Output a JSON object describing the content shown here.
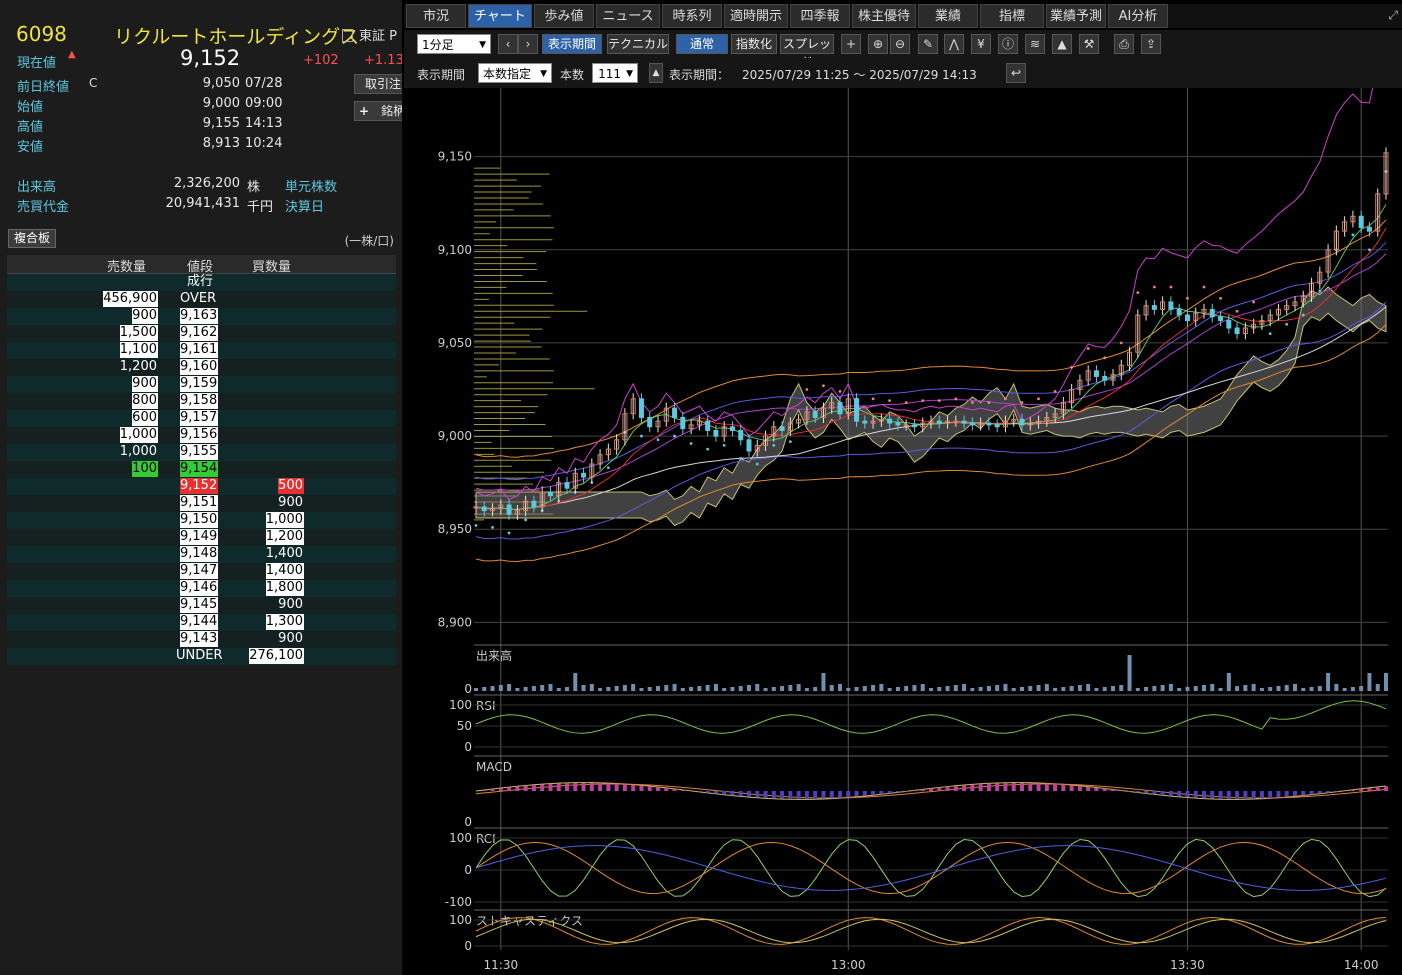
{
  "quote": {
    "code": "6098",
    "name": "リクルートホールディングス",
    "market": "東証 P",
    "current_label": "現在値",
    "current_price": "9,152",
    "change": "+102",
    "change_pct": "+1.13",
    "prev_close_label": "前日終値",
    "prev_close_flag": "C",
    "prev_close": "9,050",
    "prev_close_date": "07/28",
    "open_label": "始値",
    "open": "9,000",
    "open_time": "09:00",
    "high_label": "高値",
    "high": "9,155",
    "high_time": "14:13",
    "low_label": "安値",
    "low": "8,913",
    "low_time": "10:24",
    "volume_label": "出来高",
    "volume": "2,326,200",
    "volume_unit": "株",
    "turnover_label": "売買代金",
    "turnover": "20,941,431",
    "turnover_unit": "千円",
    "unit_shares_label": "単元株数",
    "settlement_label": "決算日",
    "side_btn1": "取引注",
    "side_btn2": "銘柄"
  },
  "board": {
    "button": "複合板",
    "unit": "(一株/口)",
    "headers": [
      "売数量",
      "値段",
      "買数量"
    ],
    "market_order": "成行",
    "over_qty": "456,900",
    "over_label": "OVER",
    "under_label": "UNDER",
    "under_qty": "276,100",
    "asks": [
      {
        "qty": "900",
        "price": "9,163"
      },
      {
        "qty": "1,500",
        "price": "9,162"
      },
      {
        "qty": "1,100",
        "price": "9,161"
      },
      {
        "qty": "1,200",
        "price": "9,160"
      },
      {
        "qty": "900",
        "price": "9,159"
      },
      {
        "qty": "800",
        "price": "9,158"
      },
      {
        "qty": "600",
        "price": "9,157"
      },
      {
        "qty": "1,000",
        "price": "9,156"
      },
      {
        "qty": "1,000",
        "price": "9,155"
      },
      {
        "qty": "100",
        "price": "9,154"
      }
    ],
    "bids": [
      {
        "price": "9,152",
        "qty": "500"
      },
      {
        "price": "9,151",
        "qty": "900"
      },
      {
        "price": "9,150",
        "qty": "1,000"
      },
      {
        "price": "9,149",
        "qty": "1,200"
      },
      {
        "price": "9,148",
        "qty": "1,400"
      },
      {
        "price": "9,147",
        "qty": "1,400"
      },
      {
        "price": "9,146",
        "qty": "1,800"
      },
      {
        "price": "9,145",
        "qty": "900"
      },
      {
        "price": "9,144",
        "qty": "1,300"
      },
      {
        "price": "9,143",
        "qty": "900"
      }
    ]
  },
  "tabs": [
    "市況",
    "チャート",
    "歩み値",
    "ニュース",
    "時系列",
    "適時開示",
    "四季報",
    "株主優待",
    "業績",
    "指標",
    "業績予測",
    "AI分析"
  ],
  "toolbar": {
    "interval": "1分足",
    "period_btn": "表示期間",
    "technical_btn": "テクニカル",
    "normal_btn": "通常",
    "index_btn": "指数化",
    "spread_btn": "スプレッド",
    "period_label": "表示期間",
    "period_mode": "本数指定",
    "count_label": "本数",
    "count": "111",
    "range_label": "表示期間：",
    "range": "2025/07/29 11:25 〜 2025/07/29 14:13"
  },
  "chart_data": {
    "type": "candlestick",
    "y_ticks": [
      9150,
      9100,
      9050,
      9000,
      8950,
      8900
    ],
    "ylim": [
      8890,
      9160
    ],
    "x_ticks": [
      "11:30",
      "13:00",
      "13:30",
      "14:00"
    ],
    "panels": [
      {
        "name": "出来高",
        "ticks": [
          "0"
        ]
      },
      {
        "name": "RSI",
        "ticks": [
          "100",
          "50",
          "0"
        ]
      },
      {
        "name": "MACD",
        "ticks": [
          "0"
        ]
      },
      {
        "name": "RCI",
        "ticks": [
          "100",
          "0",
          "-100"
        ]
      },
      {
        "name": "ストキャスティクス",
        "ticks": [
          "100",
          "0"
        ]
      }
    ],
    "close": [
      8962,
      8960,
      8961,
      8963,
      8958,
      8960,
      8965,
      8962,
      8970,
      8968,
      8975,
      8972,
      8980,
      8978,
      8985,
      8990,
      8993,
      8998,
      9012,
      9020,
      9010,
      9005,
      9008,
      9015,
      9010,
      9004,
      9006,
      9008,
      9003,
      9000,
      9005,
      9003,
      8998,
      8992,
      8995,
      9000,
      9005,
      9003,
      9007,
      9009,
      9013,
      9010,
      9015,
      9018,
      9012,
      9020,
      9008,
      9007,
      9008,
      9009,
      9007,
      9006,
      9006,
      9005,
      9007,
      9008,
      9007,
      9008,
      9008,
      9007,
      9006,
      9007,
      9006,
      9005,
      9008,
      9009,
      9006,
      9007,
      9008,
      9010,
      9012,
      9018,
      9025,
      9030,
      9035,
      9032,
      9030,
      9033,
      9038,
      9045,
      9065,
      9070,
      9068,
      9072,
      9068,
      9065,
      9062,
      9066,
      9068,
      9064,
      9062,
      9058,
      9055,
      9058,
      9060,
      9062,
      9065,
      9068,
      9070,
      9072,
      9075,
      9082,
      9088,
      9100,
      9110,
      9115,
      9118,
      9112,
      9110,
      9130,
      9152
    ]
  }
}
